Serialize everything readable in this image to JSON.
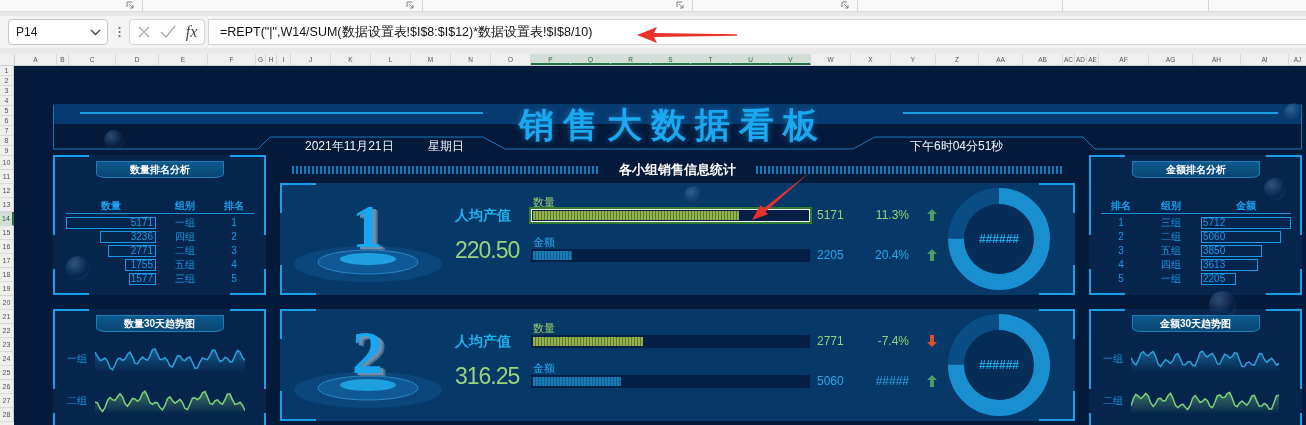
{
  "name_box": {
    "value": "P14"
  },
  "formula_bar": {
    "fx_label": "fx",
    "formula": "=REPT(\"|\",W14/SUM(数据设置表!$I$8:$I$12)*数据设置表!$I$8/10)"
  },
  "columns": [
    {
      "label": "A",
      "selected": false
    },
    {
      "label": "B",
      "selected": false
    },
    {
      "label": "C",
      "selected": false
    },
    {
      "label": "D",
      "selected": false
    },
    {
      "label": "E",
      "selected": false
    },
    {
      "label": "F",
      "selected": false
    },
    {
      "label": "G",
      "selected": false
    },
    {
      "label": "H",
      "selected": false
    },
    {
      "label": "I",
      "selected": false
    },
    {
      "label": "J",
      "selected": false
    },
    {
      "label": "K",
      "selected": false
    },
    {
      "label": "L",
      "selected": false
    },
    {
      "label": "M",
      "selected": false
    },
    {
      "label": "N",
      "selected": false
    },
    {
      "label": "O",
      "selected": false
    },
    {
      "label": "P",
      "selected": true
    },
    {
      "label": "Q",
      "selected": true
    },
    {
      "label": "R",
      "selected": true
    },
    {
      "label": "S",
      "selected": true
    },
    {
      "label": "T",
      "selected": true
    },
    {
      "label": "U",
      "selected": true
    },
    {
      "label": "V",
      "selected": true
    },
    {
      "label": "W",
      "selected": false
    },
    {
      "label": "X",
      "selected": false
    },
    {
      "label": "Y",
      "selected": false
    },
    {
      "label": "Z",
      "selected": false
    },
    {
      "label": "AA",
      "selected": false
    },
    {
      "label": "AB",
      "selected": false
    },
    {
      "label": "AC",
      "selected": false
    },
    {
      "label": "AD",
      "selected": false
    },
    {
      "label": "AE",
      "selected": false
    },
    {
      "label": "AF",
      "selected": false
    },
    {
      "label": "AG",
      "selected": false
    },
    {
      "label": "AH",
      "selected": false
    },
    {
      "label": "AI",
      "selected": false
    },
    {
      "label": "AJ",
      "selected": false
    }
  ],
  "rows": [
    {
      "label": "1",
      "selected": false
    },
    {
      "label": "2",
      "selected": false
    },
    {
      "label": "3",
      "selected": false
    },
    {
      "label": "4",
      "selected": false
    },
    {
      "label": "5",
      "selected": false
    },
    {
      "label": "6",
      "selected": false
    },
    {
      "label": "7",
      "selected": false
    },
    {
      "label": "8",
      "selected": false
    },
    {
      "label": "9",
      "selected": false
    },
    {
      "label": "10",
      "selected": false
    },
    {
      "label": "11",
      "selected": false
    },
    {
      "label": "12",
      "selected": false
    },
    {
      "label": "13",
      "selected": false
    },
    {
      "label": "14",
      "selected": true
    },
    {
      "label": "15",
      "selected": false
    },
    {
      "label": "16",
      "selected": false
    },
    {
      "label": "17",
      "selected": false
    },
    {
      "label": "18",
      "selected": false
    },
    {
      "label": "19",
      "selected": false
    },
    {
      "label": "20",
      "selected": false
    },
    {
      "label": "21",
      "selected": false
    },
    {
      "label": "22",
      "selected": false
    },
    {
      "label": "23",
      "selected": false
    },
    {
      "label": "24",
      "selected": false
    },
    {
      "label": "25",
      "selected": false
    },
    {
      "label": "26",
      "selected": false
    },
    {
      "label": "27",
      "selected": false
    },
    {
      "label": "28",
      "selected": false
    }
  ],
  "dashboard": {
    "title": "销售大数据看板",
    "date": "2021年11月21日",
    "weekday": "星期日",
    "time": "下午6时04分51秒",
    "quantity_ranking": {
      "title": "数量排名分析",
      "headers": [
        "数量",
        "组别",
        "排名"
      ],
      "rows": [
        {
          "value": "5171",
          "group": "一组",
          "rank": "1"
        },
        {
          "value": "3236",
          "group": "四组",
          "rank": "2"
        },
        {
          "value": "2771",
          "group": "二组",
          "rank": "3"
        },
        {
          "value": "1755",
          "group": "五组",
          "rank": "4"
        },
        {
          "value": "1577",
          "group": "三组",
          "rank": "5"
        }
      ]
    },
    "quantity_trend": {
      "title": "数量30天趋势图",
      "series": [
        {
          "label": "一组",
          "color": "#2e9fd8"
        },
        {
          "label": "二组",
          "color": "#7ed07a"
        }
      ]
    },
    "section_title": "各小组销售信息统计",
    "cards": [
      {
        "rank": "1",
        "metric_label": "人均产值",
        "metric_value": "220.50",
        "donut": {
          "text": "######",
          "level": 0.75
        },
        "bars": [
          {
            "kind": "quantity",
            "label": "数量",
            "level": 0.75,
            "selected": true,
            "value": "5171",
            "change": "11.3%",
            "rising": true
          },
          {
            "kind": "amount",
            "label": "金额",
            "level": 0.14,
            "selected": false,
            "value": "2205",
            "change": "20.4%",
            "rising": true
          }
        ]
      },
      {
        "rank": "2",
        "metric_label": "人均产值",
        "metric_value": "316.25",
        "donut": {
          "text": "######",
          "level": 0.75
        },
        "bars": [
          {
            "kind": "quantity",
            "label": "数量",
            "level": 0.4,
            "selected": false,
            "value": "2771",
            "change": "-7.4%",
            "rising": false
          },
          {
            "kind": "amount",
            "label": "金额",
            "level": 0.32,
            "selected": false,
            "value": "5060",
            "change": "#####",
            "rising": true
          }
        ]
      }
    ],
    "amount_ranking": {
      "title": "金额排名分析",
      "headers": [
        "排名",
        "组别",
        "金额"
      ],
      "rows": [
        {
          "rank": "1",
          "group": "三组",
          "value": "5712"
        },
        {
          "rank": "2",
          "group": "二组",
          "value": "5060"
        },
        {
          "rank": "3",
          "group": "五组",
          "value": "3850"
        },
        {
          "rank": "4",
          "group": "四组",
          "value": "3613"
        },
        {
          "rank": "5",
          "group": "一组",
          "value": "2205"
        }
      ]
    },
    "amount_trend": {
      "title": "金额30天趋势图",
      "series": [
        {
          "label": "一组",
          "color": "#2e9fd8"
        },
        {
          "label": "二组",
          "color": "#7ed07a"
        }
      ]
    }
  }
}
